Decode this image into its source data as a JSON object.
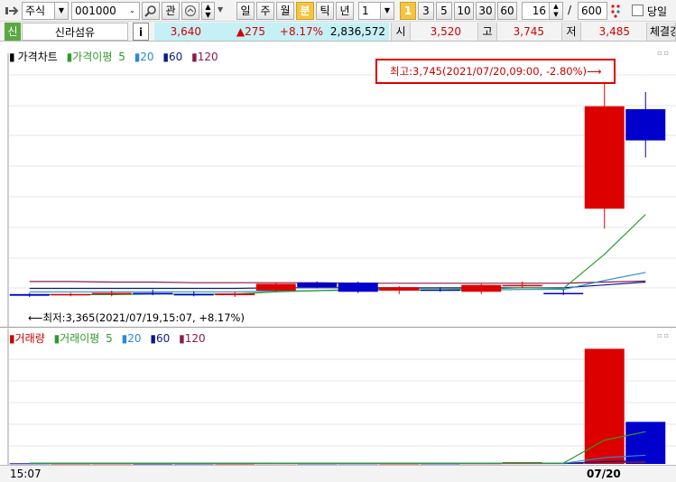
{
  "toolbar": {
    "market_select": "주식",
    "code_input": "001000",
    "gwan_button": "관",
    "periods": [
      "일",
      "주",
      "월",
      "분",
      "틱",
      "년"
    ],
    "active_period": "분",
    "interval_value": "1",
    "minute_options": [
      "1",
      "3",
      "5",
      "10",
      "30",
      "60"
    ],
    "active_minute": "1",
    "view_count": "16",
    "slash": "/",
    "total_count": "600",
    "same_day_label": "당일"
  },
  "quote": {
    "badge": "신",
    "stock_name": "신라섬유",
    "info_button": "i",
    "price": "3,640",
    "change": "▲275",
    "change_rate": "+8.17%",
    "volume": "2,836,572",
    "open_label": "시",
    "open_value": "3,520",
    "high_label": "고",
    "high_value": "3,745",
    "low_label": "저",
    "low_value": "3,485",
    "trade_label": "체결강"
  },
  "price_chart": {
    "legend": {
      "main": "가격차트",
      "ma_label": "가격이평",
      "ma5": "5",
      "ma20": "20",
      "ma60": "60",
      "ma120": "120"
    },
    "high_annotation": "최고:3,745(2021/07/20,09:00, -2.80%)⟶",
    "low_annotation": "⟵최저:3,365(2021/07/19,15:07, +8.17%)"
  },
  "volume_chart": {
    "legend": {
      "main": "거래량",
      "ma_label": "거래이평",
      "ma5": "5",
      "ma20": "20",
      "ma60": "60",
      "ma120": "120"
    }
  },
  "time_axis": {
    "start_label": "15:07",
    "date_label": "07/20"
  },
  "colors": {
    "up": "#dd0000",
    "down": "#0000cc",
    "ma5": "#2e9a2e",
    "ma20": "#2a8ad4",
    "ma60": "#0b1a88",
    "ma120": "#8b1a4a",
    "highlight_box": "#dd0000"
  },
  "chart_data": [
    {
      "type": "candlestick",
      "title": "가격차트",
      "ylim": [
        3330,
        3790
      ],
      "candles": [
        {
          "index": 0,
          "open": 3370,
          "high": 3372,
          "low": 3365,
          "close": 3367
        },
        {
          "index": 1,
          "open": 3368,
          "high": 3372,
          "low": 3366,
          "close": 3370
        },
        {
          "index": 2,
          "open": 3370,
          "high": 3376,
          "low": 3366,
          "close": 3372
        },
        {
          "index": 3,
          "open": 3372,
          "high": 3378,
          "low": 3368,
          "close": 3370
        },
        {
          "index": 4,
          "open": 3370,
          "high": 3375,
          "low": 3366,
          "close": 3368
        },
        {
          "index": 5,
          "open": 3368,
          "high": 3374,
          "low": 3365,
          "close": 3371
        },
        {
          "index": 6,
          "open": 3376,
          "high": 3390,
          "low": 3374,
          "close": 3388
        },
        {
          "index": 7,
          "open": 3390,
          "high": 3392,
          "low": 3380,
          "close": 3382
        },
        {
          "index": 8,
          "open": 3390,
          "high": 3392,
          "low": 3372,
          "close": 3374
        },
        {
          "index": 9,
          "open": 3376,
          "high": 3384,
          "low": 3370,
          "close": 3382
        },
        {
          "index": 10,
          "open": 3378,
          "high": 3382,
          "low": 3374,
          "close": 3376
        },
        {
          "index": 11,
          "open": 3374,
          "high": 3388,
          "low": 3370,
          "close": 3386
        },
        {
          "index": 12,
          "open": 3384,
          "high": 3392,
          "low": 3380,
          "close": 3386
        },
        {
          "index": 13,
          "open": 3372,
          "high": 3378,
          "low": 3368,
          "close": 3370
        },
        {
          "index": 14,
          "open": 3520,
          "high": 3745,
          "low": 3485,
          "close": 3700
        },
        {
          "index": 15,
          "open": 3695,
          "high": 3725,
          "low": 3610,
          "close": 3640
        }
      ],
      "ma5": [
        3369,
        3369,
        3369,
        3370,
        3370,
        3370,
        3374,
        3376,
        3378,
        3380,
        3380,
        3379,
        3381,
        3380,
        3440,
        3510
      ],
      "ma20": [
        3374,
        3374,
        3374,
        3374,
        3374,
        3374,
        3375,
        3376,
        3377,
        3377,
        3377,
        3377,
        3378,
        3378,
        3394,
        3408
      ],
      "ma60": [
        3380,
        3380,
        3380,
        3380,
        3380,
        3380,
        3381,
        3381,
        3381,
        3381,
        3381,
        3381,
        3381,
        3381,
        3386,
        3391
      ],
      "ma120": [
        3392,
        3392,
        3391,
        3391,
        3390,
        3390,
        3390,
        3390,
        3389,
        3389,
        3389,
        3389,
        3389,
        3389,
        3391,
        3393
      ]
    },
    {
      "type": "bar",
      "title": "거래량",
      "ylim": [
        0,
        1500000
      ],
      "values": [
        8000,
        6000,
        7000,
        5000,
        6000,
        5000,
        9000,
        7000,
        8000,
        6000,
        7000,
        9000,
        22000,
        14000,
        1450000,
        530000
      ],
      "ma5": [
        8000,
        7500,
        7000,
        6500,
        6400,
        5800,
        6400,
        6400,
        7000,
        7000,
        7400,
        7400,
        10400,
        11600,
        300000,
        406000
      ],
      "ma20": [
        7000,
        7000,
        7000,
        7000,
        7000,
        7000,
        7000,
        7000,
        7000,
        7000,
        7000,
        7000,
        7500,
        8000,
        80000,
        110000
      ],
      "ma60": [
        6500,
        6500,
        6500,
        6500,
        6500,
        6500,
        6500,
        6500,
        6500,
        6500,
        6500,
        6500,
        6600,
        6700,
        30000,
        39000
      ],
      "ma120": [
        6000,
        6000,
        6000,
        6000,
        6000,
        6000,
        6000,
        6000,
        6000,
        6000,
        6000,
        6000,
        6000,
        6100,
        18000,
        22000
      ]
    }
  ]
}
